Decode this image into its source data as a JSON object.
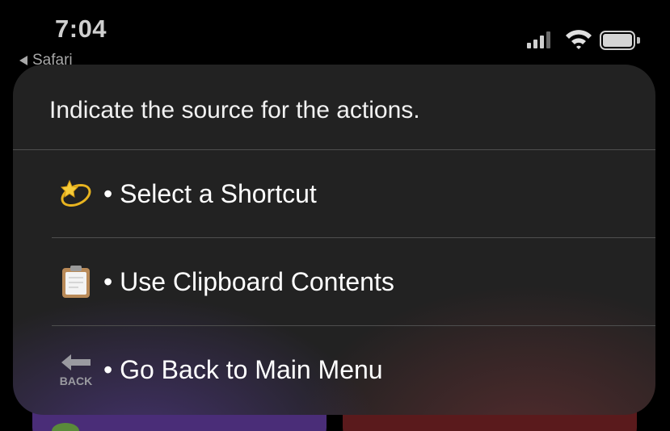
{
  "status_bar": {
    "time": "7:04",
    "back_app": "Safari",
    "battery_level": 1.0,
    "signal_bars_active": 3,
    "signal_bars_total": 4
  },
  "menu": {
    "prompt": "Indicate the source for the actions.",
    "items": [
      {
        "label": "• Select a Shortcut",
        "icon": "dizzy-star-icon"
      },
      {
        "label": "• Use Clipboard Contents",
        "icon": "clipboard-icon"
      },
      {
        "label": "• Go Back to Main Menu",
        "icon": "back-arrow-icon",
        "icon_text": "BACK"
      }
    ]
  },
  "colors": {
    "background": "#000000",
    "panel": "#222222",
    "text": "#ffffff",
    "divider": "#4e4e4e"
  }
}
